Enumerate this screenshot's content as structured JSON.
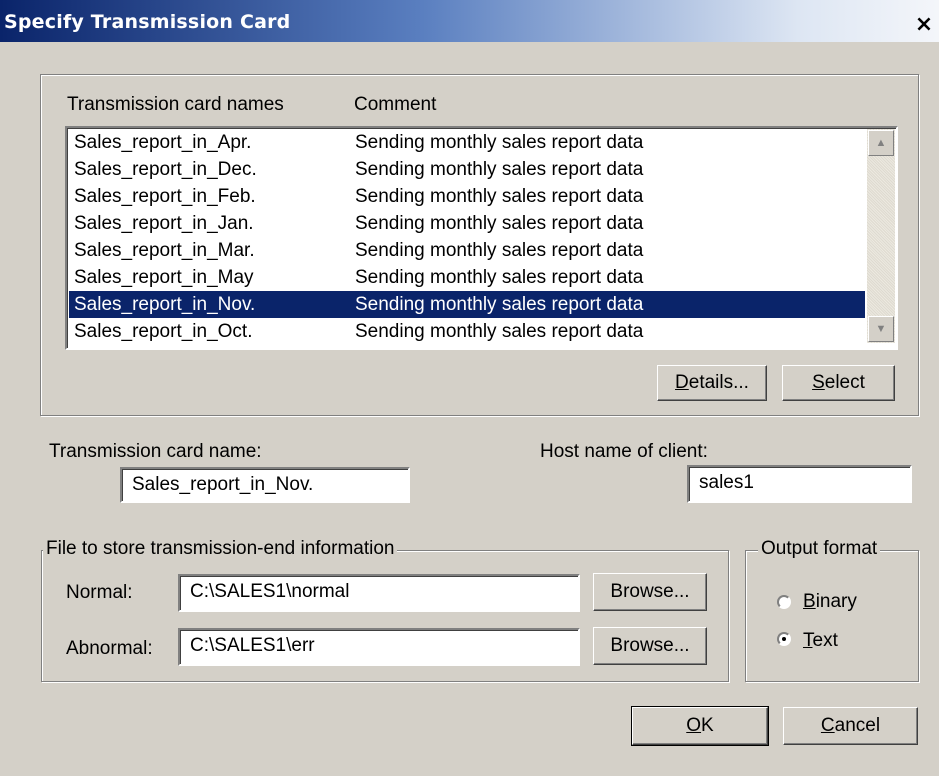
{
  "window": {
    "title": "Specify Transmission Card"
  },
  "list": {
    "header_names": "Transmission card names",
    "header_comment": "Comment",
    "rows": [
      {
        "name": "Sales_report_in_Apr.",
        "comment": "Sending monthly sales report data"
      },
      {
        "name": "Sales_report_in_Dec.",
        "comment": "Sending monthly sales report data"
      },
      {
        "name": "Sales_report_in_Feb.",
        "comment": "Sending monthly sales report data"
      },
      {
        "name": "Sales_report_in_Jan.",
        "comment": "Sending monthly sales report data"
      },
      {
        "name": "Sales_report_in_Mar.",
        "comment": "Sending monthly sales report data"
      },
      {
        "name": "Sales_report_in_May",
        "comment": "Sending monthly sales report data"
      },
      {
        "name": "Sales_report_in_Nov.",
        "comment": "Sending monthly sales report data"
      },
      {
        "name": "Sales_report_in_Oct.",
        "comment": "Sending monthly sales report data"
      }
    ],
    "selected_index": 6
  },
  "buttons": {
    "details_key": "D",
    "details_rest": "etails...",
    "select_key": "S",
    "select_rest": "elect",
    "browse": "Browse...",
    "ok_key": "O",
    "ok_rest": "K",
    "cancel_key": "C",
    "cancel_rest": "ancel"
  },
  "card_name": {
    "label": "Transmission card name:",
    "value": "Sales_report_in_Nov."
  },
  "host": {
    "label": "Host name of client:",
    "value": "sales1"
  },
  "file_group": {
    "title": "File to store transmission-end information",
    "normal_label": "Normal:",
    "normal_value": "C:\\SALES1\\normal",
    "abnormal_label": "Abnormal:",
    "abnormal_value": "C:\\SALES1\\err"
  },
  "output_format": {
    "title": "Output format",
    "binary_key": "B",
    "binary_rest": "inary",
    "text_key": "T",
    "text_rest": "ext",
    "selected": "Text"
  }
}
